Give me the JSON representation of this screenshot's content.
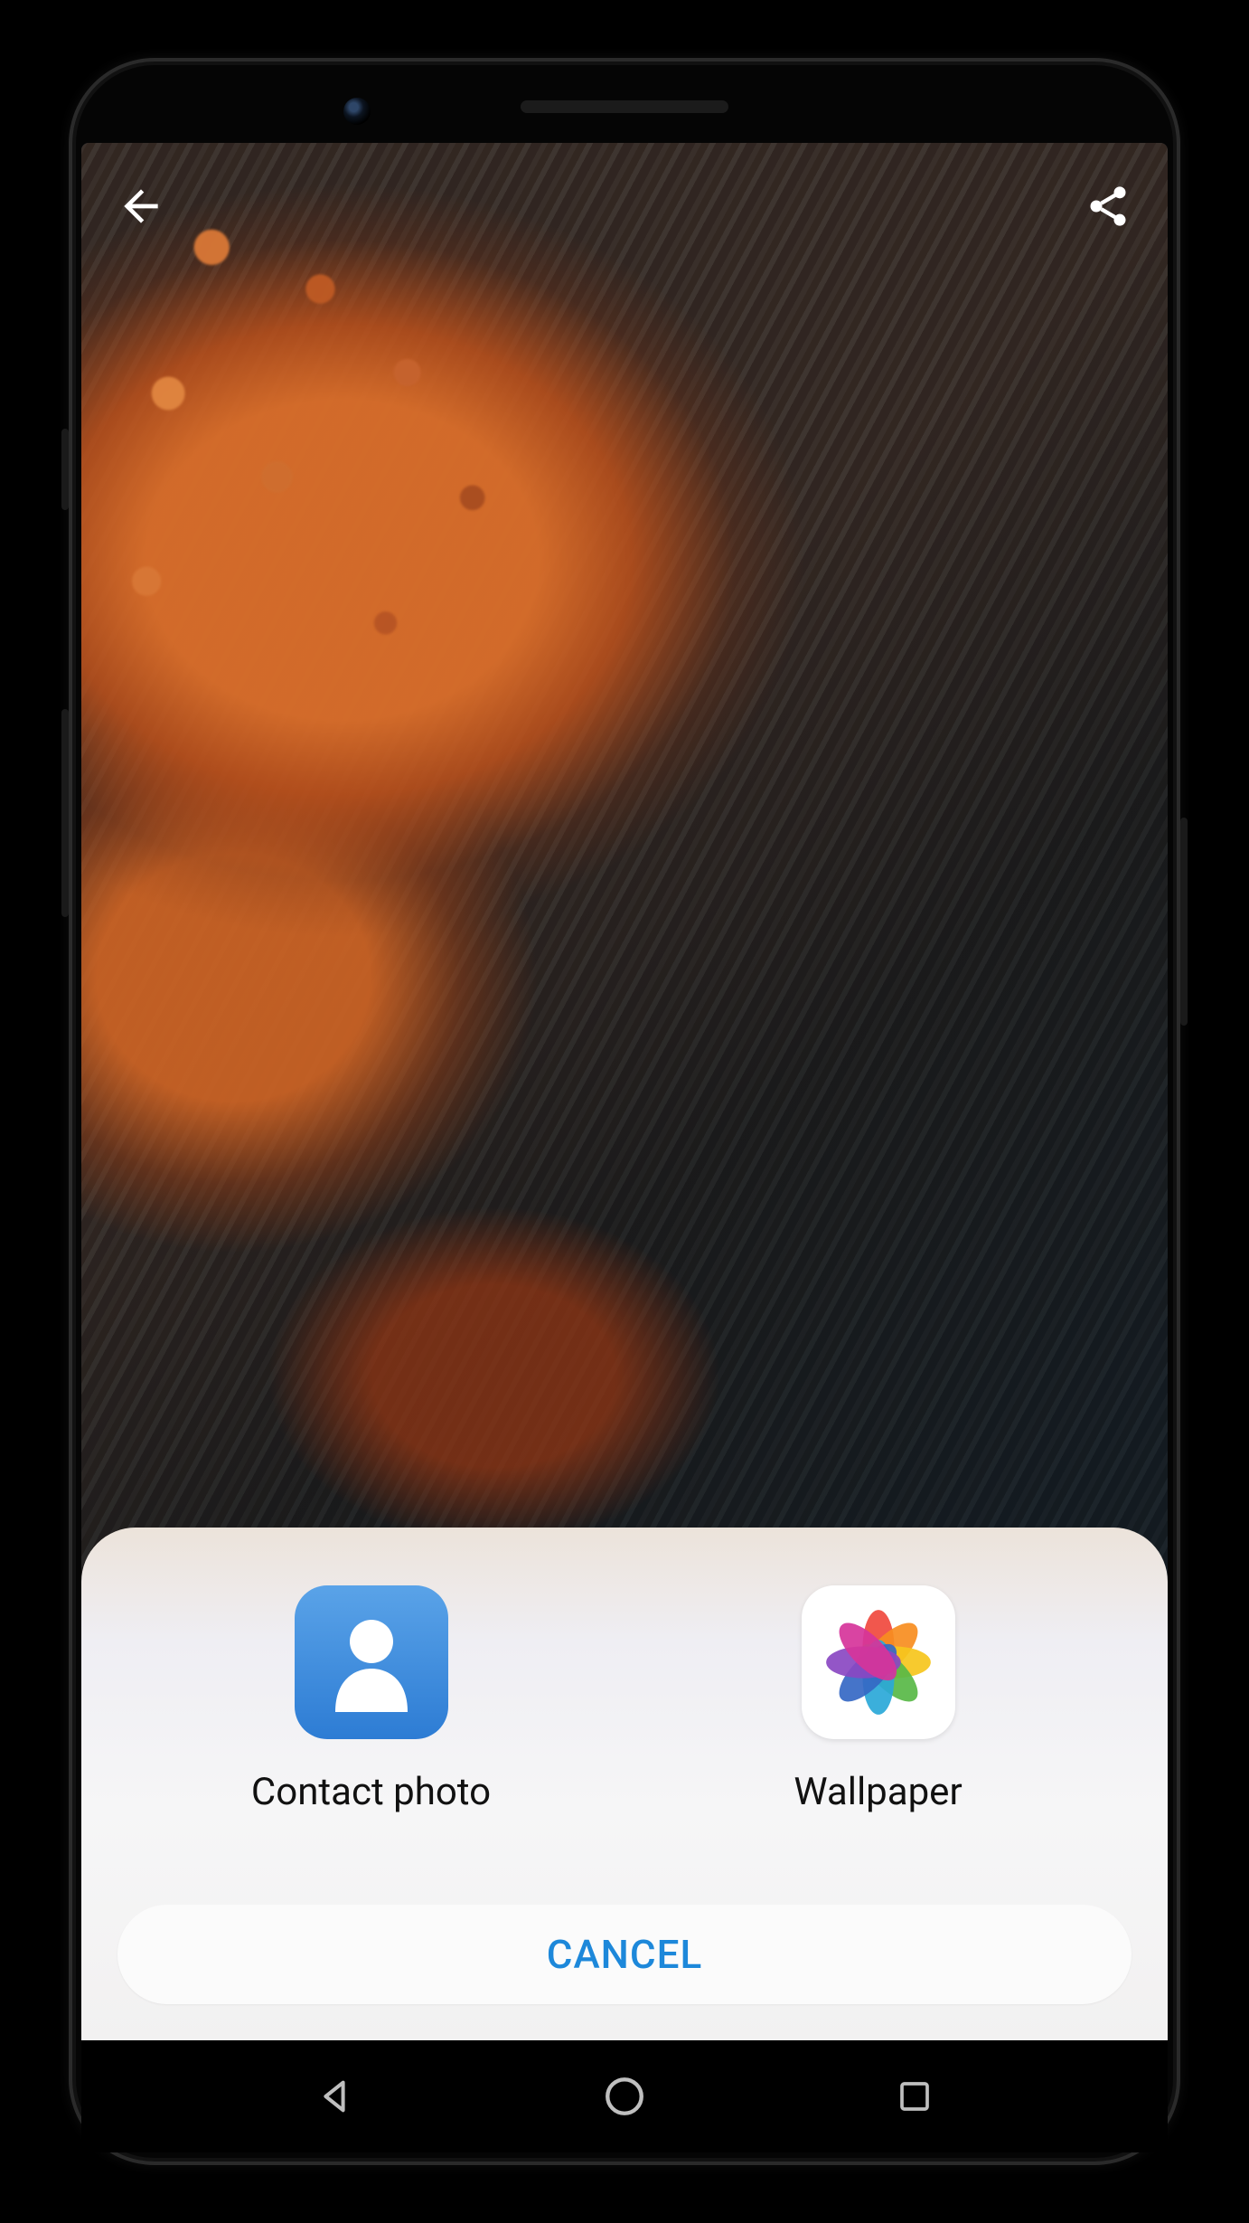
{
  "sheet": {
    "options": [
      {
        "label": "Contact photo"
      },
      {
        "label": "Wallpaper"
      }
    ],
    "cancel_label": "CANCEL"
  }
}
